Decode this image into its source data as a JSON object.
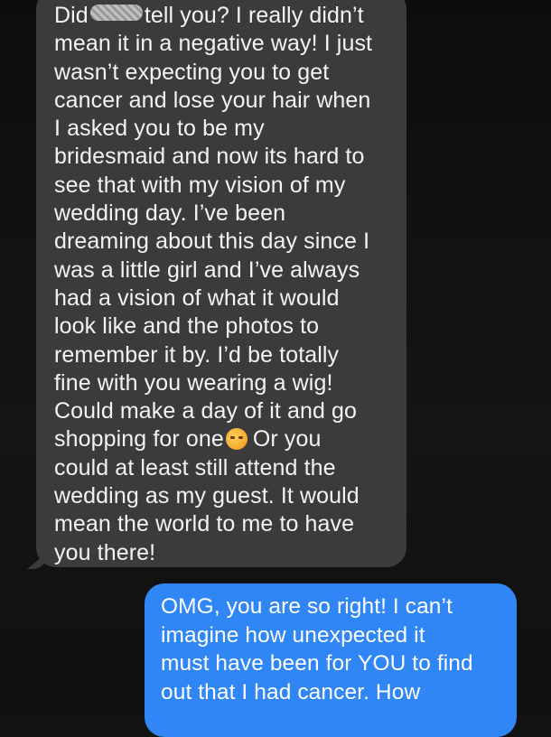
{
  "received_message": {
    "line_1_before": "Did",
    "line_1_after": "tell you? I really didn’t",
    "lines": [
      "mean it in a negative way! I just",
      "wasn’t expecting you to get",
      "cancer and lose your hair when",
      "I asked you to be my",
      "bridesmaid and now its hard to",
      "see that with my vision of my",
      "wedding day. I’ve been",
      "dreaming about this day since I",
      "was a little girl and I’ve always",
      "had a vision of what it would",
      "look like and the photos to",
      "remember it by. I’d be totally",
      "fine with you wearing a wig!",
      "Could make a day of it and go"
    ],
    "emoji_line_before": "shopping for one",
    "emoji_line_after": "Or you",
    "emoji_icon": "smiling-face-with-hearts-icon",
    "lines_end": [
      "could at least still attend the",
      "wedding as my guest. It would",
      "mean the world to me to have",
      "you there!"
    ],
    "bubble_color": "#3b3b3d"
  },
  "sent_message": {
    "lines": [
      "OMG, you are so right! I can’t",
      "imagine how unexpected it",
      "must have been for YOU to find",
      "out that I had cancer. How"
    ],
    "bubble_color": "#2f86f4"
  }
}
